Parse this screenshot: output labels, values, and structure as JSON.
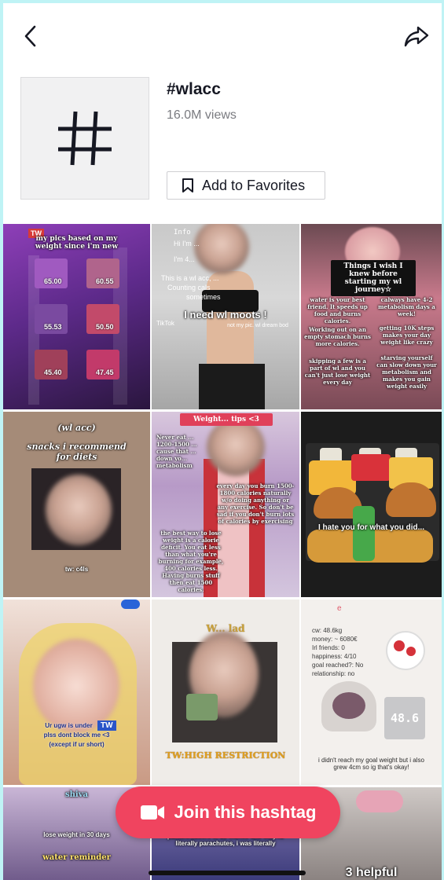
{
  "header": {
    "title": "#wlacc",
    "views": "16.0M views",
    "favorites_label": "Add to Favorites"
  },
  "icons": {
    "back": "chevron-left-icon",
    "share": "share-arrow-icon",
    "hashtag": "hashtag-icon",
    "bookmark": "bookmark-icon",
    "video": "video-camera-icon"
  },
  "videos": [
    {
      "tw": "TW",
      "title": "my pics based on my weight since i'm new",
      "weights": [
        "65.00",
        "60.55",
        "55.53",
        "50.50",
        "45.40",
        "47.45"
      ]
    },
    {
      "info": "Info",
      "lines": [
        "Hi I'm ...",
        "I'm 4...",
        "This is a wl acc, ...",
        "Counting cals",
        "sometimes"
      ],
      "caption": "I need wl moots !",
      "sub": "not my pic. wl dream bod",
      "brand": "TikTok"
    },
    {
      "heading": "Things I wish I knew before starting my wl journey☆",
      "tips": [
        "water is your best friend. It speeds up food and burns calories.",
        "calways have 4-2 metabolism days a week!",
        "Working out on an empty stomach burns more calories.",
        "getting 10K steps makes your day weight like crazy",
        "skipping a few is a part of wl and you can't just lose weight every day",
        "starving yourself can slow down your metabolism and makes you gain weight easily"
      ]
    },
    {
      "heading": "(wl acc)",
      "title": "snacks i recommend for diets",
      "footer": "tw: c4ls"
    },
    {
      "title": "Weight... tips <3",
      "tips": [
        "Never eat ... 1200-1500 ... cause that ... down yo... metabolism",
        "every day you burn 1500-1800 calories naturally w/o doing anything or any exercise. So don't be sad if you don't burn lots of calories by exercising",
        "the best way to lose weight is a calorie deficit. You eat less than what you're burning for example, 400 calories less. Having burns stuff then eat 1500 calories."
      ]
    },
    {
      "caption": "I hate you for what you did..."
    },
    {
      "caption": "Ur ugw is under",
      "tw": "TW",
      "caption2": "plss dont block me <3",
      "caption3": "(except if ur short)"
    },
    {
      "top": "W... lad",
      "bottom": "TW:HIGH RESTRICTION"
    },
    {
      "e": "e",
      "stats": [
        "cw: 48.6kg",
        "money: ~ 6080€",
        "Irl friends: 0",
        "happiness: 4/10",
        "goal reached?: No",
        "relationship: no"
      ],
      "scale": "48.6",
      "footer": "i didn't reach my goal weight but i also grew 4cm so ig that's okay!"
    },
    {
      "title": "shiva",
      "caption": "lose weight in 30 days",
      "caption2": "water reminder"
    },
    {
      "caption": "pants/trousers in 28 inches and they're literally parachutes, i was literally"
    },
    {
      "caption": "3 helpful"
    }
  ],
  "join_label": "Join this hashtag"
}
